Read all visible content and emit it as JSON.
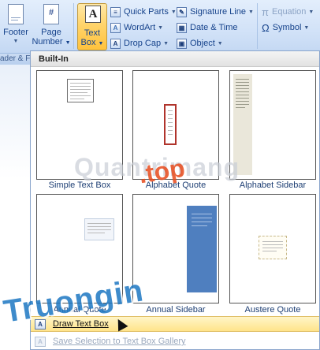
{
  "ribbon": {
    "footer_label": "Footer",
    "page_number_label_1": "Page",
    "page_number_label_2": "Number",
    "page_number_glyph": "#",
    "textbox_label_1": "Text",
    "textbox_label_2": "Box",
    "textbox_glyph": "A",
    "quick_parts": "Quick Parts",
    "wordart": "WordArt",
    "drop_cap": "Drop Cap",
    "signature_line": "Signature Line",
    "date_time": "Date & Time",
    "object": "Object",
    "equation": "Equation",
    "symbol": "Symbol",
    "equation_glyph": "π",
    "symbol_glyph": "Ω",
    "group_label": "ader & F"
  },
  "gallery": {
    "header": "Built-In",
    "items": [
      {
        "label": "Simple Text Box"
      },
      {
        "label": "Alphabet Quote"
      },
      {
        "label": "Alphabet Sidebar"
      },
      {
        "label": "Annual Quote"
      },
      {
        "label": "Annual Sidebar"
      },
      {
        "label": "Austere Quote"
      }
    ]
  },
  "menu": {
    "draw_text_box": "Draw Text Box",
    "save_selection": "Save Selection to Text Box Gallery"
  },
  "watermark": {
    "big": "Truongin",
    "top": ".top",
    "mid": "Quantrimang"
  },
  "colors": {
    "ribbon_bg": "#d3e3f8",
    "highlight": "#ffd46b",
    "accent_blue": "#4f7fbf",
    "text_blue": "#15428b"
  }
}
